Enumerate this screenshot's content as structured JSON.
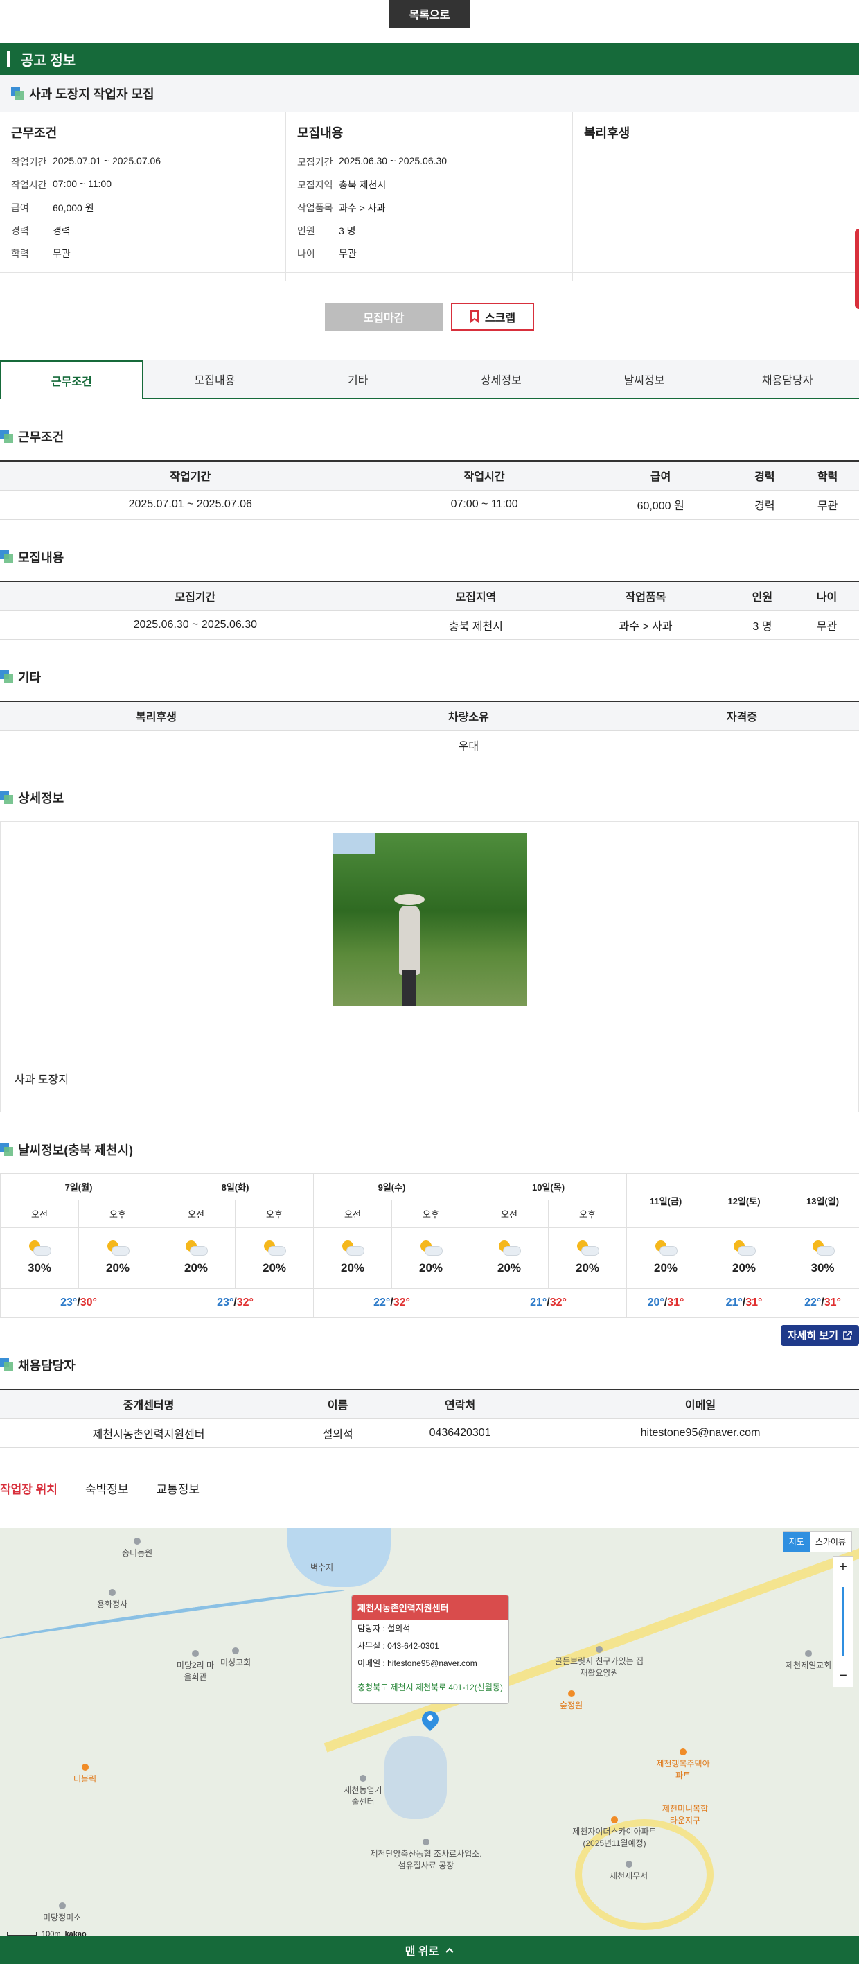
{
  "top": {
    "list_btn": "목록으로"
  },
  "notice": {
    "title": "공고 정보"
  },
  "job": {
    "title": "사과 도장지 작업자 모집"
  },
  "summary": {
    "work": {
      "heading": "근무조건",
      "rows": [
        {
          "k": "작업기간",
          "v": "2025.07.01 ~ 2025.07.06"
        },
        {
          "k": "작업시간",
          "v": "07:00 ~ 11:00"
        },
        {
          "k": "급여",
          "v": "60,000 원"
        },
        {
          "k": "경력",
          "v": "경력"
        },
        {
          "k": "학력",
          "v": "무관"
        }
      ]
    },
    "recruit": {
      "heading": "모집내용",
      "rows": [
        {
          "k": "모집기간",
          "v": "2025.06.30 ~ 2025.06.30"
        },
        {
          "k": "모집지역",
          "v": "충북 제천시"
        },
        {
          "k": "작업품목",
          "v": "과수 > 사과"
        },
        {
          "k": "인원",
          "v": "3 명"
        },
        {
          "k": "나이",
          "v": "무관"
        }
      ]
    },
    "welfare": {
      "heading": "복리후생"
    }
  },
  "actions": {
    "closed": "모집마감",
    "scrap": "스크랩"
  },
  "tabs": [
    "근무조건",
    "모집내용",
    "기타",
    "상세정보",
    "날씨정보",
    "채용담당자"
  ],
  "work_table": {
    "title": "근무조건",
    "headers": [
      "작업기간",
      "작업시간",
      "급여",
      "경력",
      "학력"
    ],
    "row": [
      "2025.07.01 ~ 2025.07.06",
      "07:00 ~ 11:00",
      "60,000 원",
      "경력",
      "무관"
    ]
  },
  "recruit_table": {
    "title": "모집내용",
    "headers": [
      "모집기간",
      "모집지역",
      "작업품목",
      "인원",
      "나이"
    ],
    "row": [
      "2025.06.30 ~ 2025.06.30",
      "충북 제천시",
      "과수 > 사과",
      "3 명",
      "무관"
    ]
  },
  "etc_table": {
    "title": "기타",
    "headers": [
      "복리후생",
      "차량소유",
      "자격증"
    ],
    "row": [
      "",
      "우대",
      ""
    ]
  },
  "detail": {
    "title": "상세정보",
    "text": "사과 도장지"
  },
  "weather": {
    "title": "날씨정보(충북 제천시)",
    "days": [
      {
        "day": "7일(월)",
        "am": {
          "label": "오전",
          "pct": "30%"
        },
        "pm": {
          "label": "오후",
          "pct": "20%"
        },
        "lo": "23°",
        "hi": "30°"
      },
      {
        "day": "8일(화)",
        "am": {
          "label": "오전",
          "pct": "20%"
        },
        "pm": {
          "label": "오후",
          "pct": "20%"
        },
        "lo": "23°",
        "hi": "32°"
      },
      {
        "day": "9일(수)",
        "am": {
          "label": "오전",
          "pct": "20%"
        },
        "pm": {
          "label": "오후",
          "pct": "20%"
        },
        "lo": "22°",
        "hi": "32°"
      },
      {
        "day": "10일(목)",
        "am": {
          "label": "오전",
          "pct": "20%"
        },
        "pm": {
          "label": "오후",
          "pct": "20%"
        },
        "lo": "21°",
        "hi": "32°"
      }
    ],
    "single_days": [
      {
        "day": "11일(금)",
        "pct": "20%",
        "lo": "20°",
        "hi": "31°"
      },
      {
        "day": "12일(토)",
        "pct": "20%",
        "lo": "21°",
        "hi": "31°"
      },
      {
        "day": "13일(일)",
        "pct": "30%",
        "lo": "22°",
        "hi": "31°"
      }
    ],
    "slash": "/",
    "more": "자세히 보기"
  },
  "manager_table": {
    "title": "채용담당자",
    "headers": [
      "중개센터명",
      "이름",
      "연락처",
      "이메일"
    ],
    "row": [
      "제천시농촌인력지원센터",
      "설의석",
      "0436420301",
      "hitestone95@naver.com"
    ]
  },
  "location_tabs": [
    "작업장 위치",
    "숙박정보",
    "교통정보"
  ],
  "map": {
    "types": [
      "지도",
      "스카이뷰"
    ],
    "zoom_in": "+",
    "zoom_out": "−",
    "info": {
      "name": "제천시농촌인력지원센터",
      "manager": "담당자 : 설의석",
      "office": "사무실 : 043-642-0301",
      "email": "이메일 : hitestone95@naver.com",
      "address": "충청북도 제천시 제천북로 401-12(신월동)"
    },
    "places": [
      {
        "name": "송디농원",
        "orange": false
      },
      {
        "name": "용화정사",
        "orange": false
      },
      {
        "name": "미당2리 마을회관",
        "orange": false
      },
      {
        "name": "미성교회",
        "orange": false
      },
      {
        "name": "더블릭",
        "orange": true
      },
      {
        "name": "제천농업기술센터",
        "orange": false
      },
      {
        "name": "제천단양축산농협 조사료사업소.섬유질사료 공장",
        "orange": false
      },
      {
        "name": "골든브릿지 친구가있는 집 재활요양원",
        "orange": false
      },
      {
        "name": "숲정원",
        "orange": true
      },
      {
        "name": "제천행복주택아파트",
        "orange": true
      },
      {
        "name": "제천자이더스카이아파트 (2025년11월예정)",
        "orange": false
      },
      {
        "name": "제천세무서",
        "orange": false
      },
      {
        "name": "제천제일교회",
        "orange": false
      },
      {
        "name": "미당정미소",
        "orange": false
      },
      {
        "name": "벽수지",
        "orange": false
      },
      {
        "name": "제천미니복합타운지구",
        "orange": true
      }
    ],
    "scale": "100m",
    "brand": "kakao"
  },
  "bottom": {
    "to_top": "맨 위로"
  }
}
